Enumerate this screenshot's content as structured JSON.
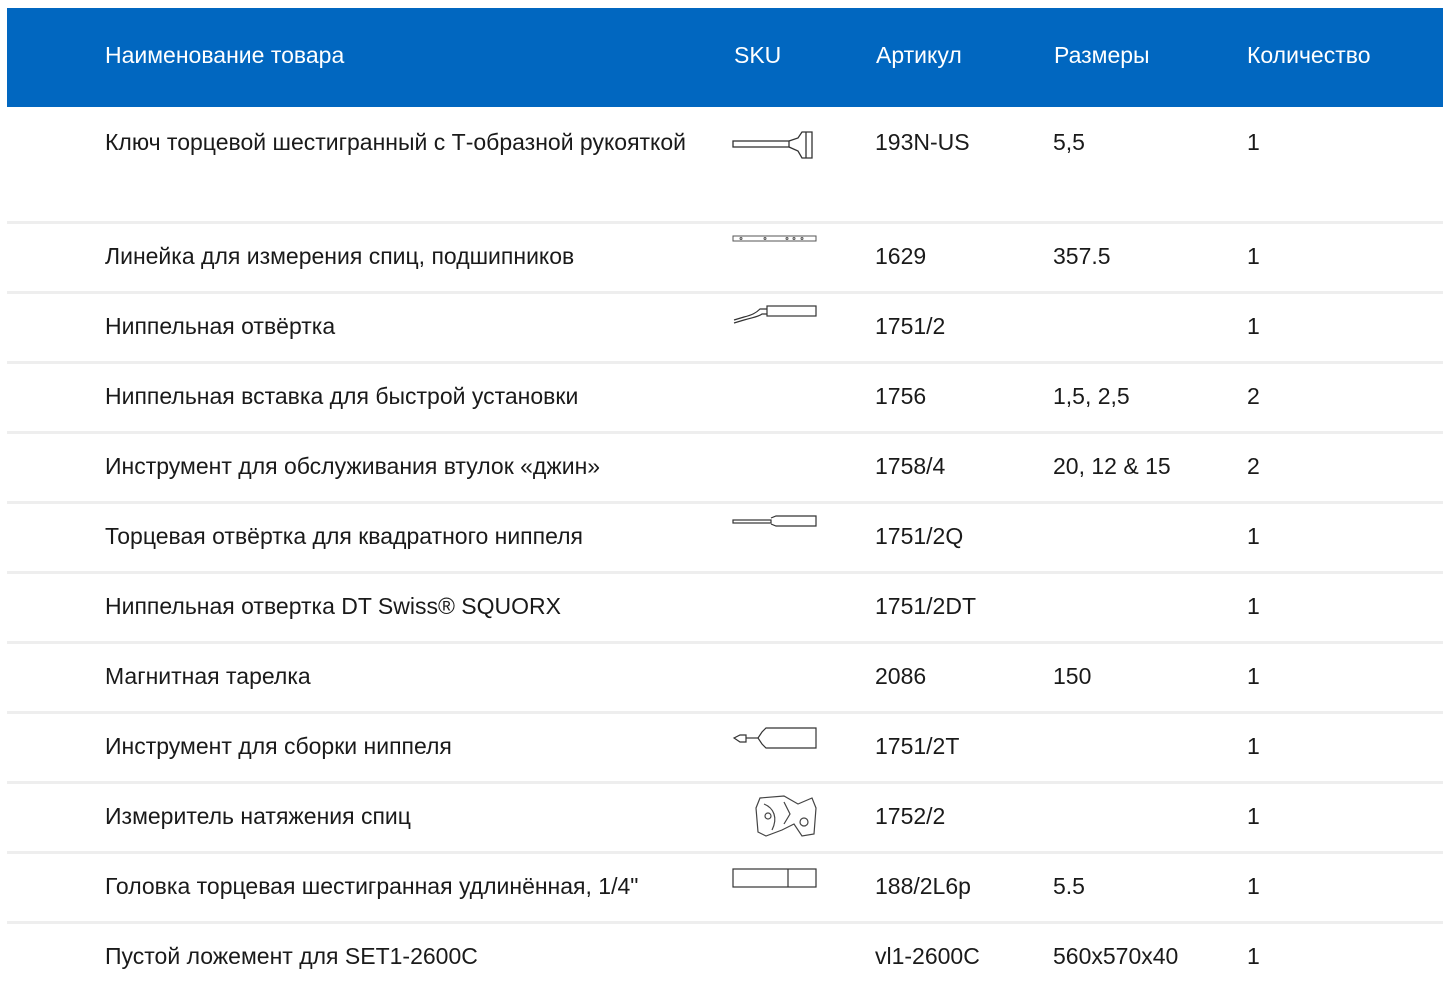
{
  "header": {
    "name": "Наименование товара",
    "sku": "SKU",
    "article": "Артикул",
    "sizes": "Размеры",
    "qty": "Количество"
  },
  "rows": [
    {
      "name": "Ключ торцевой шестигранный с Т-образной рукояткой",
      "icon": "t-handle-hex-key-icon",
      "article": "193N-US",
      "size": "5,5",
      "qty": "1"
    },
    {
      "name": "Линейка для измерения спиц, подшипников",
      "icon": "ruler-icon",
      "article": "1629",
      "size": "357.5",
      "qty": "1"
    },
    {
      "name": "Ниппельная отвёртка",
      "icon": "nipple-screwdriver-icon",
      "article": "1751/2",
      "size": "",
      "qty": "1"
    },
    {
      "name": "Ниппельная вставка для быстрой установки",
      "icon": "",
      "article": "1756",
      "size": "1,5, 2,5",
      "qty": "2"
    },
    {
      "name": "Инструмент для обслуживания втулок «джин»",
      "icon": "",
      "article": "1758/4",
      "size": "20, 12 & 15",
      "qty": "2"
    },
    {
      "name": "Торцевая отвёртка для квадратного ниппеля",
      "icon": "square-nipple-driver-icon",
      "article": "1751/2Q",
      "size": "",
      "qty": "1"
    },
    {
      "name": "Ниппельная отвертка DT Swiss® SQUORX",
      "icon": "",
      "article": "1751/2DT",
      "size": "",
      "qty": "1"
    },
    {
      "name": "Магнитная тарелка",
      "icon": "",
      "article": "2086",
      "size": "150",
      "qty": "1"
    },
    {
      "name": "Инструмент для сборки ниппеля",
      "icon": "nipple-assembly-tool-icon",
      "article": "1751/2T",
      "size": "",
      "qty": "1"
    },
    {
      "name": "Измеритель натяжения спиц",
      "icon": "spoke-tension-meter-icon",
      "article": "1752/2",
      "size": "",
      "qty": "1"
    },
    {
      "name": "Головка торцевая шестигранная удлинённая, 1/4\"",
      "icon": "hex-socket-icon",
      "article": "188/2L6p",
      "size": "5.5",
      "qty": "1"
    },
    {
      "name": "Пустой ложемент для SET1-2600C",
      "icon": "",
      "article": "vl1-2600C",
      "size": "560x570x40",
      "qty": "1"
    }
  ]
}
